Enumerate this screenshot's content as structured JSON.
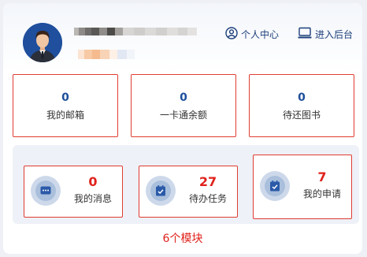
{
  "header": {
    "links": [
      {
        "label": "个人中心",
        "icon": "user-circle-icon"
      },
      {
        "label": "进入后台",
        "icon": "monitor-icon"
      }
    ]
  },
  "stats": [
    {
      "value": "0",
      "label": "我的邮箱"
    },
    {
      "value": "0",
      "label": "一卡通余额"
    },
    {
      "value": "0",
      "label": "待还图书"
    }
  ],
  "modules": [
    {
      "value": "0",
      "label": "我的消息",
      "icon": "message-icon"
    },
    {
      "value": "27",
      "label": "待办任务",
      "icon": "task-check-icon"
    },
    {
      "value": "7",
      "label": "我的申请",
      "icon": "application-check-icon"
    }
  ],
  "caption": "6个模块",
  "colors": {
    "accent": "#1d4f9c",
    "highlight": "#e0211b",
    "border": "#e03c32"
  }
}
